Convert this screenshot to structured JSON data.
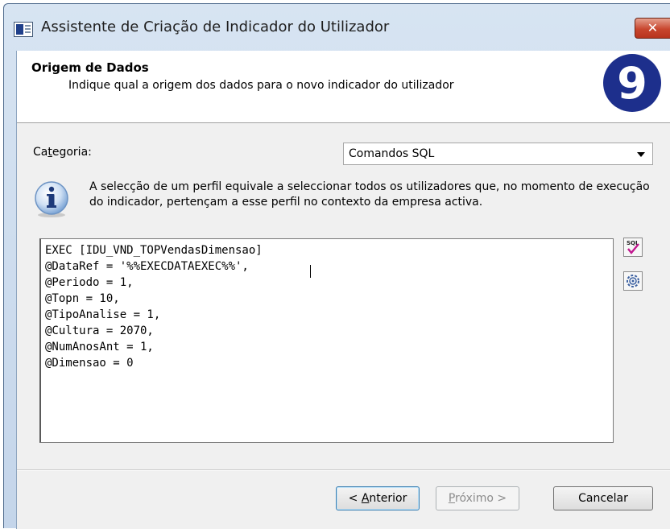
{
  "window": {
    "title": "Assistente de Criação de Indicador do Utilizador",
    "close_glyph": "✕"
  },
  "header": {
    "title": "Origem de Dados",
    "subtitle": "Indique qual a origem dos dados para o novo indicador do utilizador",
    "logo_glyph": "9"
  },
  "category": {
    "label_pre": "Ca",
    "label_accel": "t",
    "label_post": "egoria:",
    "selected": "Comandos SQL"
  },
  "info": {
    "icon": "info-icon",
    "text": "A selecção de um perfil equivale a seleccionar todos os utilizadores que, no momento de execução do indicador, pertençam a esse perfil no contexto da empresa activa."
  },
  "sql": {
    "lines": [
      "EXEC [IDU_VND_TOPVendasDimensao]",
      "@DataRef = '%%EXECDATAEXEC%%',",
      "@Periodo = 1,",
      "@Topn = 10,",
      "@TipoAnalise = 1,",
      "@Cultura = 2070,",
      "@NumAnosAnt = 1,",
      "@Dimensao = 0"
    ]
  },
  "side_buttons": {
    "sql_label": "SQL",
    "gear": "gear-icon"
  },
  "footer": {
    "back_pre": "< ",
    "back_accel": "A",
    "back_post": "nterior",
    "next_accel": "P",
    "next_post": "róximo >",
    "cancel": "Cancelar"
  },
  "colors": {
    "logo_blue": "#1d2f8c",
    "close_red": "#c8462e"
  }
}
